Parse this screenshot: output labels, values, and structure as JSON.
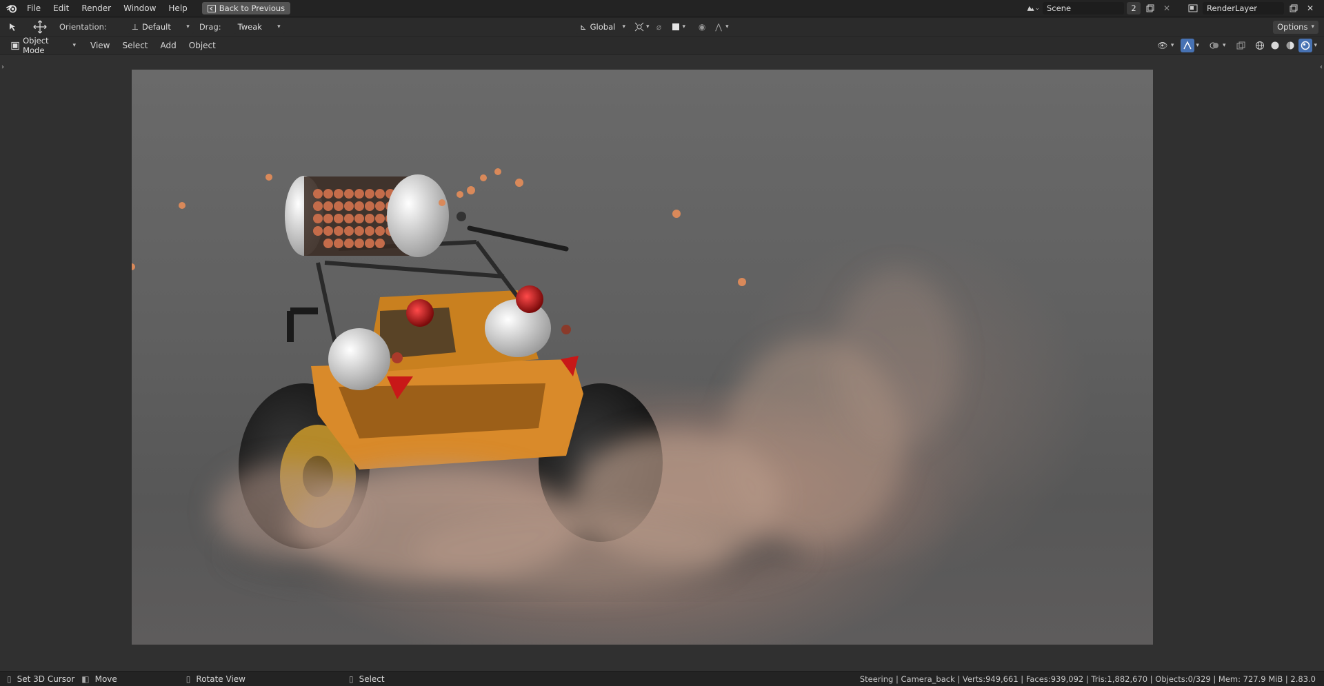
{
  "topbar": {
    "menus": [
      "File",
      "Edit",
      "Render",
      "Window",
      "Help"
    ],
    "back_button": "Back to Previous",
    "scene_name": "Scene",
    "scene_users": "2",
    "view_layer": "RenderLayer"
  },
  "tool_header": {
    "orientation_label": "Orientation:",
    "orientation_value": "Default",
    "drag_label": "Drag:",
    "drag_value": "Tweak",
    "transform_orientation": "Global",
    "options_label": "Options"
  },
  "viewport_header": {
    "mode": "Object Mode",
    "menus": [
      "View",
      "Select",
      "Add",
      "Object"
    ]
  },
  "status": {
    "hints": [
      {
        "label": "Set 3D Cursor"
      },
      {
        "label": "Move"
      },
      {
        "label": "Rotate View"
      },
      {
        "label": "Select"
      }
    ],
    "info": "Steering | Camera_back | Verts:949,661 | Faces:939,092 | Tris:1,882,670 | Objects:0/329 | Mem: 727.9 MiB | 2.83.0"
  },
  "colors": {
    "header_bg": "#2b2b2b",
    "topbar_bg": "#232323",
    "accent": "#4772b3",
    "vehicle_orange": "#d98a2a",
    "render_bg": "#626262"
  }
}
